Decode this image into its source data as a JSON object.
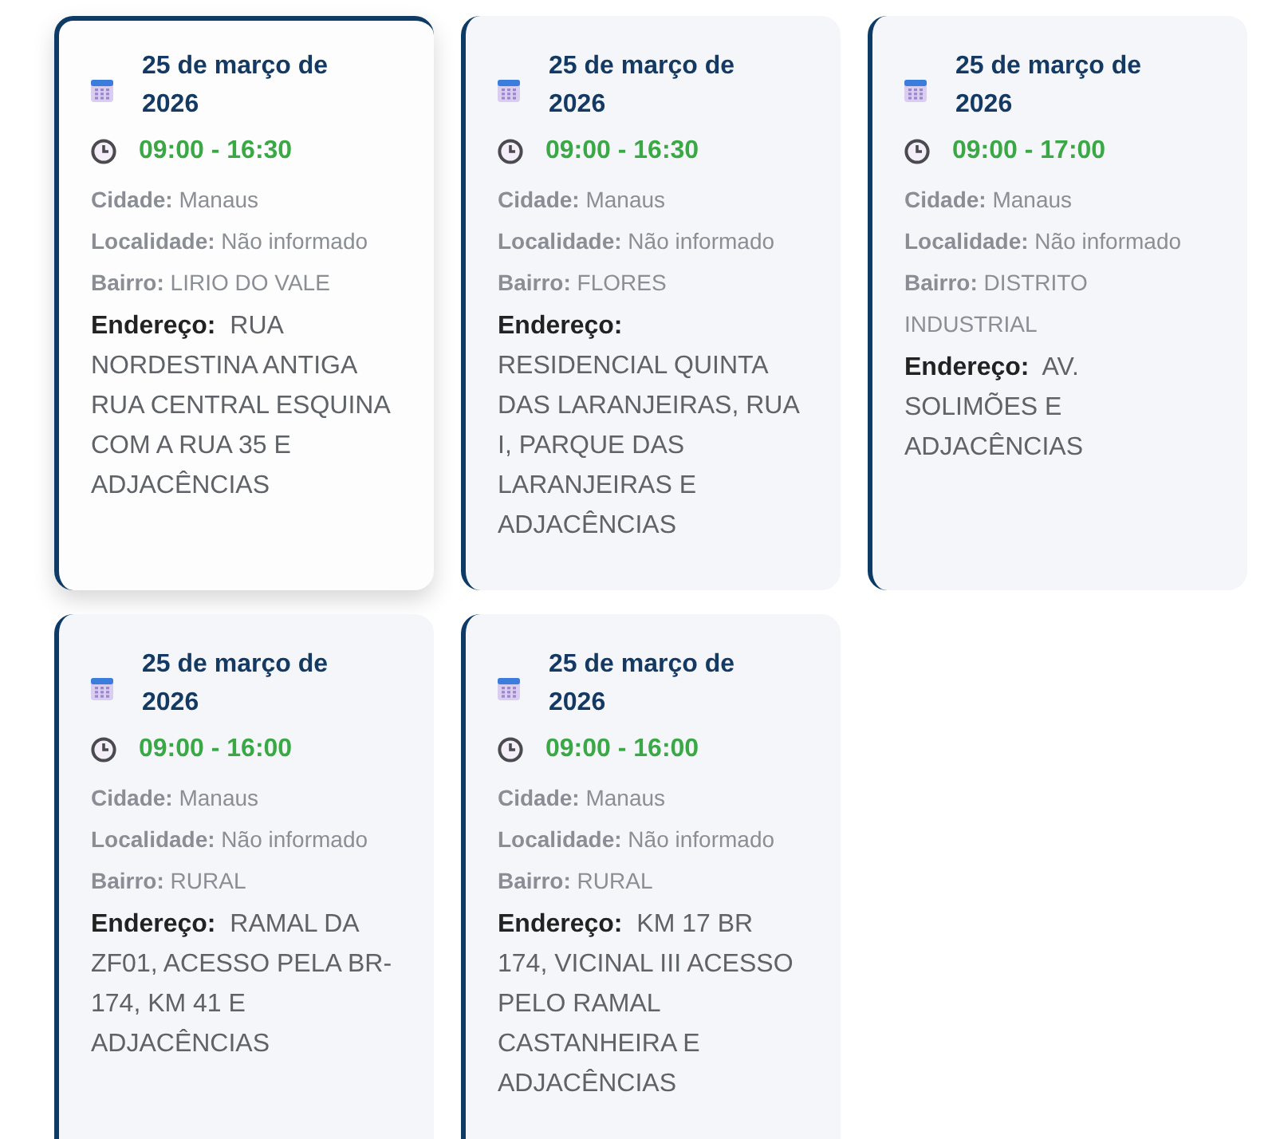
{
  "cards": [
    {
      "highlighted": true,
      "date": "25 de março de 2026",
      "time": "09:00 - 16:30",
      "details": [
        "**Cidade:** Manaus",
        "**Localidade:** Não informado",
        "**Bairro:** LIRIO DO VALE"
      ],
      "address": "**Endereço:**  RUA NORDESTINA ANTIGA RUA CENTRAL ESQUINA COM A RUA 35 E ADJACÊNCIAS"
    },
    {
      "highlighted": false,
      "date": "25 de março de 2026",
      "time": "09:00 - 16:30",
      "details": [
        "**Cidade:** Manaus",
        "**Localidade:** Não informado",
        "**Bairro:** FLORES"
      ],
      "address": "**Endereço:**  RESIDENCIAL QUINTA DAS LARANJEIRAS, RUA I, PARQUE DAS LARANJEIRAS E ADJACÊNCIAS"
    },
    {
      "highlighted": false,
      "date": "25 de março de 2026",
      "time": "09:00 - 17:00",
      "details": [
        "**Cidade:** Manaus",
        "**Localidade:** Não informado",
        "**Bairro:** DISTRITO INDUSTRIAL"
      ],
      "address": "**Endereço:**  AV. SOLIMÕES E ADJACÊNCIAS"
    },
    {
      "highlighted": false,
      "date": "25 de março de 2026",
      "time": "09:00 - 16:00",
      "details": [
        "**Cidade:** Manaus",
        "**Localidade:** Não informado",
        "**Bairro:** RURAL"
      ],
      "address": "**Endereço:**  RAMAL DA ZF01, ACESSO PELA BR-174, KM 41 E ADJACÊNCIAS"
    },
    {
      "highlighted": false,
      "date": "25 de março de 2026",
      "time": "09:00 - 16:00",
      "details": [
        "**Cidade:** Manaus",
        "**Localidade:** Não informado",
        "**Bairro:** RURAL"
      ],
      "address": "**Endereço:**  KM 17 BR 174, VICINAL III ACESSO PELO RAMAL CASTANHEIRA E ADJACÊNCIAS"
    }
  ]
}
